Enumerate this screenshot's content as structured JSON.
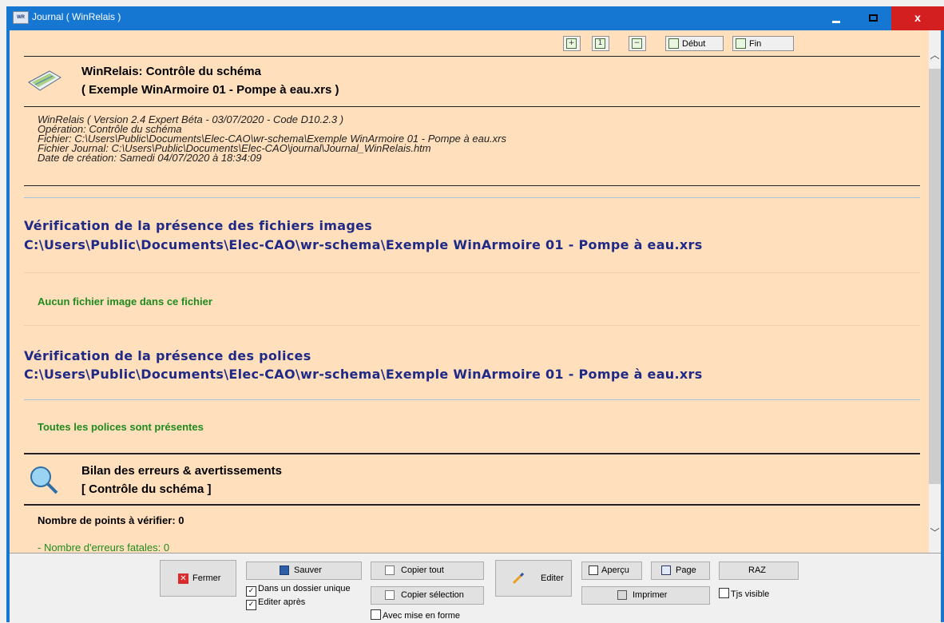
{
  "window": {
    "title": "Journal ( WinRelais )",
    "icon_text": "WR",
    "minimize_icon": "minimize-icon",
    "maximize_icon": "maximize-icon",
    "close_label": "x"
  },
  "toolbar": {
    "zoom_in_icon": "zoom-in-icon",
    "zoom_reset_icon": "zoom-reset-icon",
    "zoom_out_icon": "zoom-out-icon",
    "debut_label": "Début",
    "fin_label": "Fin"
  },
  "header": {
    "title": "WinRelais: Contrôle du schéma",
    "subtitle": "( Exemple WinArmoire 01 - Pompe à eau.xrs )"
  },
  "meta": [
    "WinRelais ( Version 2.4 Expert Béta - 03/07/2020 - Code D10.2.3 )",
    "Opération: Contrôle du schéma",
    "Fichier: C:\\Users\\Public\\Documents\\Elec-CAO\\wr-schema\\Exemple WinArmoire 01 - Pompe à eau.xrs",
    "Fichier Journal: C:\\Users\\Public\\Documents\\Elec-CAO\\journal\\Journal_WinRelais.htm",
    "Date de création: Samedi 04/07/2020 à 18:34:09"
  ],
  "section1": {
    "title": "Vérification de la présence des fichiers images",
    "path": "C:\\Users\\Public\\Documents\\Elec-CAO\\wr-schema\\Exemple WinArmoire 01 - Pompe à eau.xrs",
    "result": "Aucun fichier image dans ce fichier"
  },
  "section2": {
    "title": "Vérification de la présence des polices",
    "path": "C:\\Users\\Public\\Documents\\Elec-CAO\\wr-schema\\Exemple WinArmoire 01 - Pompe à eau.xrs",
    "result": "Toutes les polices sont présentes"
  },
  "summary": {
    "title": "Bilan des erreurs & avertissements",
    "subtitle": "[ Contrôle du schéma ]",
    "points": "Nombre de points à vérifier: 0",
    "fatal": "- Nombre d'erreurs fatales: 0"
  },
  "footer": {
    "fermer": "Fermer",
    "sauver": "Sauver",
    "dossier_unique": "Dans un dossier unique",
    "editer_apres": "Editer après",
    "copier_tout": "Copier tout",
    "copier_selection": "Copier sélection",
    "avec_mise_en_forme": "Avec mise en forme",
    "editer": "Editer",
    "apercu": "Aperçu",
    "page": "Page",
    "imprimer": "Imprimer",
    "raz": "RAZ",
    "tjs_visible": "Tjs visible",
    "checked_mark": "✓"
  },
  "colors": {
    "titlebar": "#1677d2",
    "close": "#d41f20",
    "content_bg": "#ffdfbc",
    "blue_text": "#1f2a86",
    "green_text": "#1f8a1f"
  }
}
